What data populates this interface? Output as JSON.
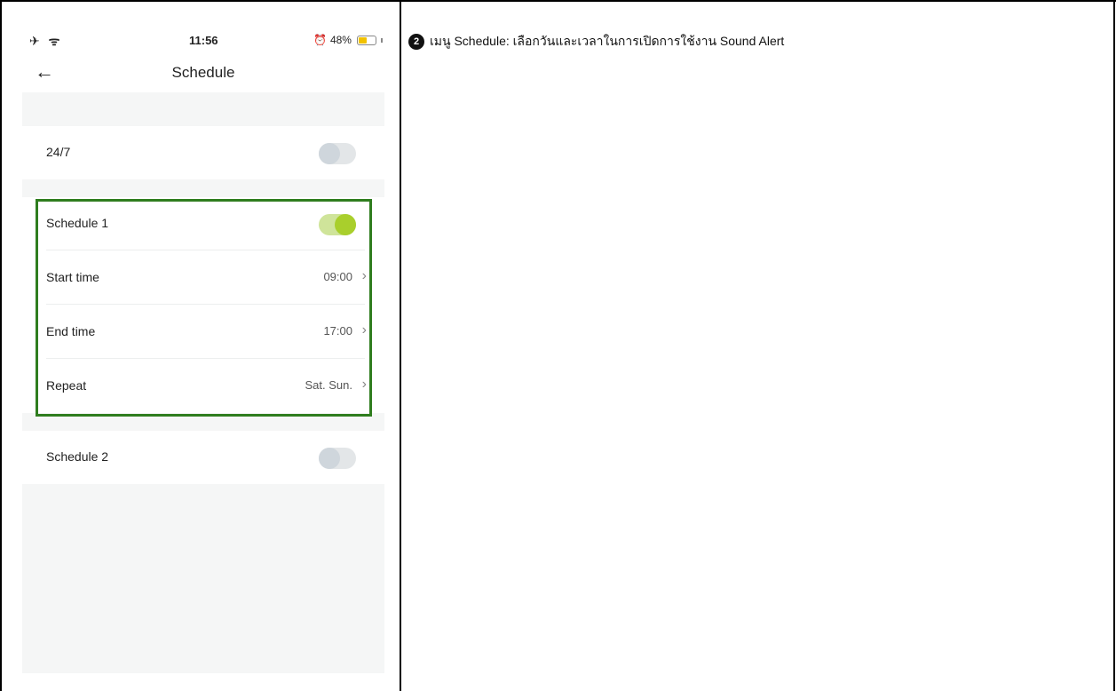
{
  "status_bar": {
    "left_icons": "✈ ᯤ",
    "time": "11:56",
    "battery_percent": "48%",
    "battery_level": 0.48
  },
  "nav": {
    "back_icon": "←",
    "title": "Schedule"
  },
  "rows": {
    "always": {
      "label": "24/7",
      "enabled": false
    },
    "schedule1": {
      "label": "Schedule 1",
      "enabled": true
    },
    "start_time": {
      "label": "Start time",
      "value": "09:00"
    },
    "end_time": {
      "label": "End time",
      "value": "17:00"
    },
    "repeat": {
      "label": "Repeat",
      "value": "Sat. Sun."
    },
    "schedule2": {
      "label": "Schedule 2",
      "enabled": false
    }
  },
  "chevron": "›",
  "annotation": {
    "badge": "2",
    "text": "เมนู Schedule: เลือกวันและเวลาในการเปิดการใช้งาน Sound Alert"
  },
  "colors": {
    "highlight": "#2f7d1e",
    "toggle_on": "#a9cf2c",
    "toggle_off": "#cfd6dc",
    "battery": "#f2c200"
  }
}
